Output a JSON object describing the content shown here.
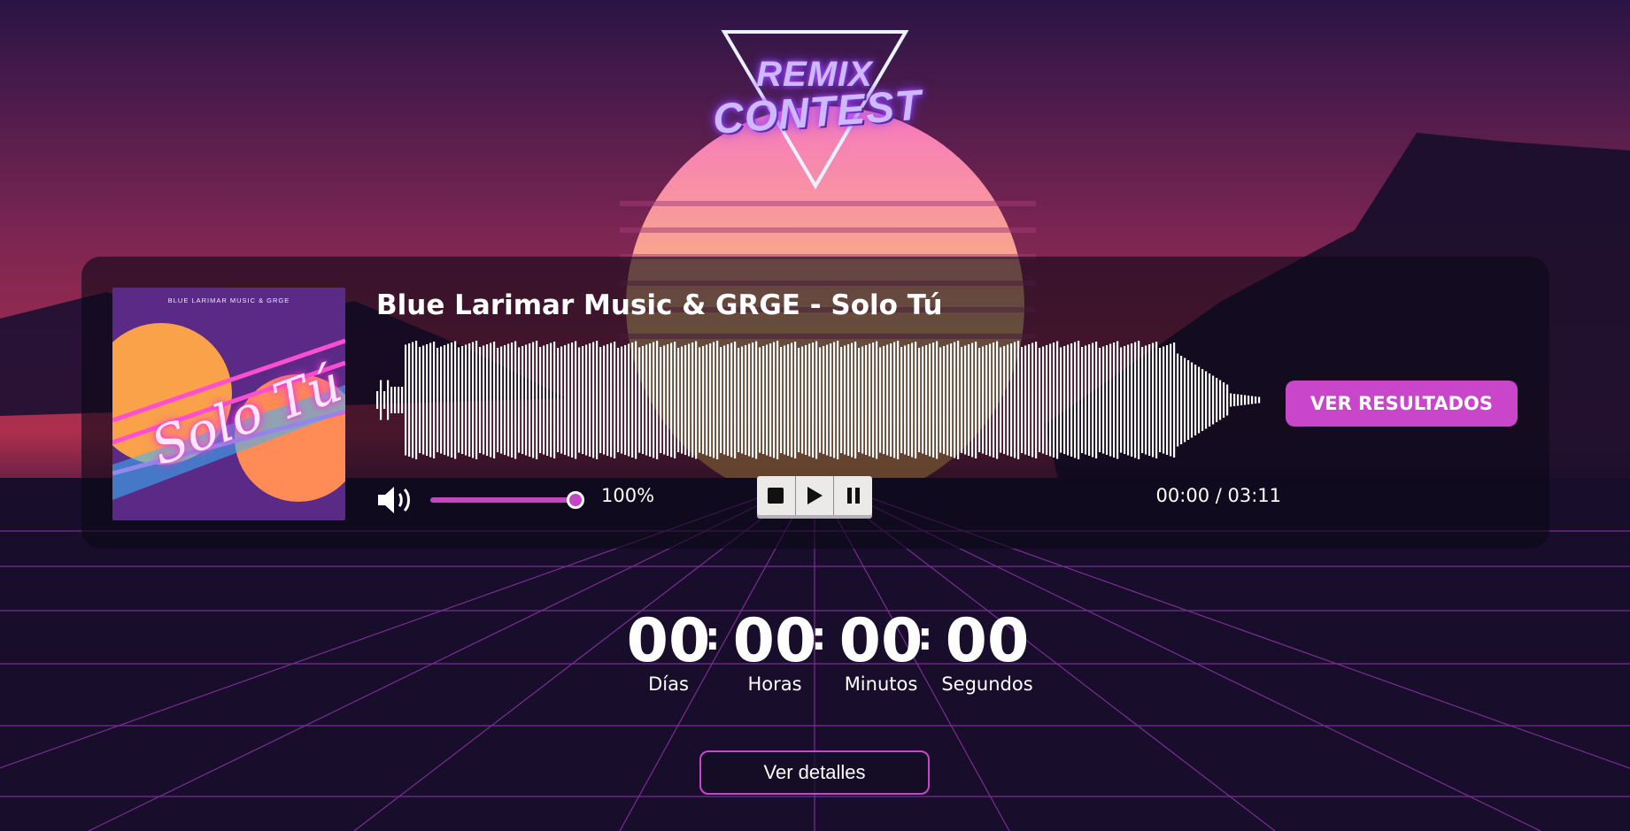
{
  "logo": {
    "line1": "REMIX",
    "line2": "CONTEST"
  },
  "player": {
    "cover": {
      "artist_line": "BLUE LARIMAR MUSIC & GRGE",
      "title_script": "Solo Tú"
    },
    "track_title": "Blue Larimar Music & GRGE - Solo Tú",
    "volume": {
      "label": "100%",
      "value_fraction": 1.0
    },
    "controls": [
      "stop",
      "play",
      "pause"
    ],
    "time": "00:00 / 03:11",
    "results_label": "VER RESULTADOS"
  },
  "countdown": {
    "units": [
      {
        "value": "00",
        "label": "Días"
      },
      {
        "value": "00",
        "label": "Horas"
      },
      {
        "value": "00",
        "label": "Minutos"
      },
      {
        "value": "00",
        "label": "Segundos"
      }
    ]
  },
  "details_label": "Ver detalles",
  "colors": {
    "accent": "#c945c9",
    "panel": "rgba(12,8,22,0.62)"
  }
}
